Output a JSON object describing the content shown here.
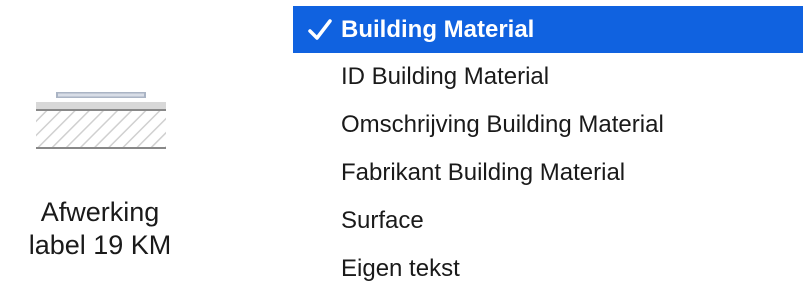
{
  "preview": {
    "label_line1": "Afwerking",
    "label_line2": "label 19 KM",
    "icon": "material-label-icon"
  },
  "menu": {
    "selected_color": "#1062e0",
    "items": [
      {
        "label": "Building Material",
        "selected": true
      },
      {
        "label": "ID Building Material",
        "selected": false
      },
      {
        "label": "Omschrijving Building Material",
        "selected": false
      },
      {
        "label": "Fabrikant Building Material",
        "selected": false
      },
      {
        "label": "Surface",
        "selected": false
      },
      {
        "label": "Eigen tekst",
        "selected": false
      }
    ],
    "check_icon": "checkmark-icon"
  }
}
